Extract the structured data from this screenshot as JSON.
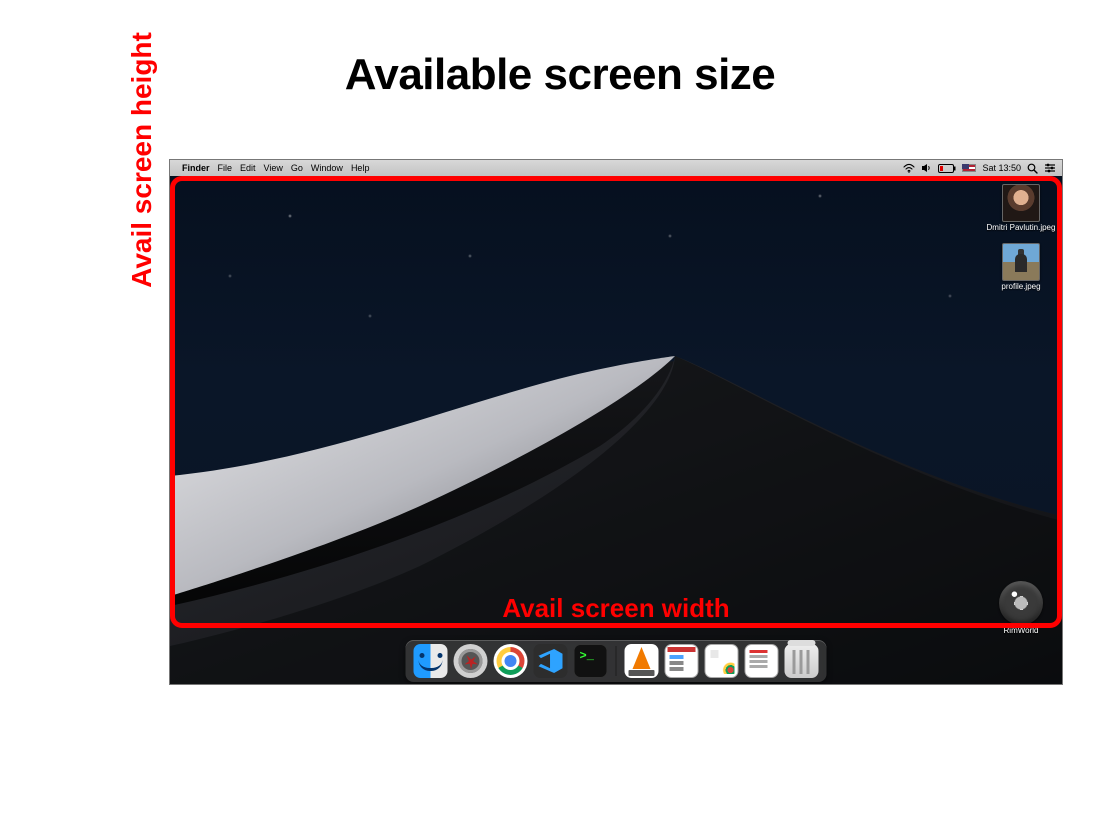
{
  "title": "Available screen size",
  "labels": {
    "height": "Avail screen height",
    "width": "Avail screen width"
  },
  "menubar": {
    "app": "Finder",
    "menus": [
      "File",
      "Edit",
      "View",
      "Go",
      "Window",
      "Help"
    ],
    "status_time": "Sat 13:50"
  },
  "desktop_icons": [
    {
      "name": "Dmitri Pavlutin.jpeg"
    },
    {
      "name": "profile.jpeg"
    }
  ],
  "desktop_app": {
    "name": "RimWorld"
  },
  "dock": {
    "apps": [
      "Finder",
      "Launchpad",
      "Chrome",
      "VSCode",
      "Terminal"
    ],
    "right": [
      "VLC",
      "Window",
      "Window",
      "Window",
      "Trash"
    ]
  }
}
